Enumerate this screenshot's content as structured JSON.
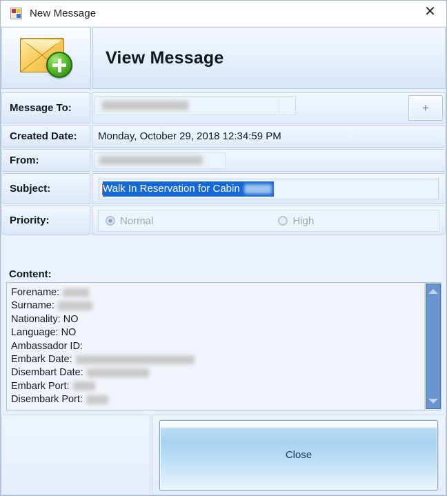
{
  "window": {
    "title": "New Message",
    "title_icon": "winforms-app-icon",
    "close_label": "✕"
  },
  "banner": {
    "icon": "new-message-envelope-icon",
    "heading": "View Message"
  },
  "form": {
    "rows": [
      {
        "key": "message_to",
        "label": "Message To:",
        "value": "",
        "redacted": true
      },
      {
        "key": "created_date",
        "label": "Created Date:",
        "value": "Monday, October 29, 2018 12:34:59 PM",
        "redacted": false
      },
      {
        "key": "from",
        "label": "From:",
        "value": "",
        "redacted": true
      },
      {
        "key": "subject",
        "label": "Subject:",
        "value": "Walk In Reservation for Cabin",
        "redacted": false
      },
      {
        "key": "priority",
        "label": "Priority:",
        "value": "Normal",
        "redacted": false
      }
    ],
    "message_to_label": "Message To:",
    "created_date_label": "Created Date:",
    "created_date_value": "Monday, October 29, 2018 12:34:59 PM",
    "from_label": "From:",
    "subject_label": "Subject:",
    "subject_value": "Walk In Reservation for Cabin",
    "priority_label": "Priority:",
    "priority_options": [
      "Normal",
      "High"
    ],
    "priority_selected": "Normal",
    "priority_normal": "Normal",
    "priority_high": "High",
    "add_recipient_label": "+"
  },
  "content": {
    "label": "Content:",
    "lines": [
      {
        "label": "Forename:",
        "value": "",
        "redacted": true,
        "redact_width": 38
      },
      {
        "label": "Surname:",
        "value": "",
        "redacted": true,
        "redact_width": 50
      },
      {
        "label": "Nationality: NO",
        "value": "",
        "redacted": false,
        "redact_width": 0
      },
      {
        "label": "Language: NO",
        "value": "",
        "redacted": false,
        "redact_width": 0
      },
      {
        "label": "Ambassador ID:",
        "value": "",
        "redacted": false,
        "redact_width": 0
      },
      {
        "label": "Embark Date:",
        "value": "",
        "redacted": true,
        "redact_width": 172
      },
      {
        "label": "Disembart Date:",
        "value": "",
        "redacted": true,
        "redact_width": 90
      },
      {
        "label": "Embark Port:",
        "value": "",
        "redacted": true,
        "redact_width": 32
      },
      {
        "label": "Disembark Port:",
        "value": "",
        "redacted": true,
        "redact_width": 32
      }
    ],
    "scrollbar": {
      "position": "right",
      "thumb": "full"
    }
  },
  "footer": {
    "close_label": "Close"
  },
  "colors": {
    "accent": "#1668d6",
    "panel": "#e6eefb",
    "border": "#b4cbe8",
    "scroll_thumb": "#6a94cd",
    "selection": "#1668d6",
    "button": "#a8d2f2"
  }
}
